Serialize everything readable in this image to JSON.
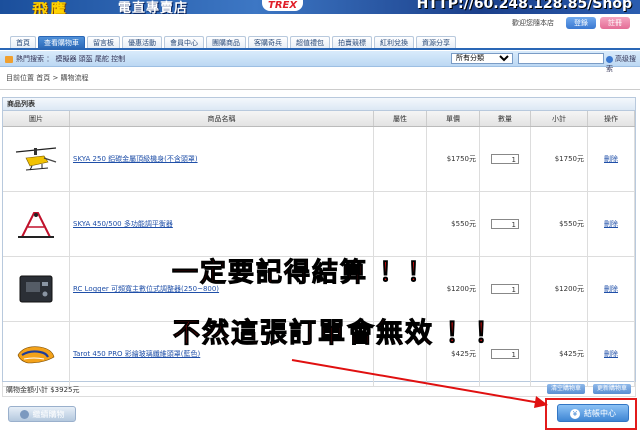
{
  "banner": {
    "logo": "飛鷹",
    "shop": "電直專賣店",
    "url": "HTTP://60.248.128.85/Shop",
    "decal": "TREX"
  },
  "user": {
    "welcome": "歡迎您隨本店",
    "login": "登錄",
    "register": "註冊"
  },
  "nav": {
    "tabs": [
      "首頁",
      "查看購物車",
      "留言板",
      "優惠活動",
      "會員中心",
      "團購商品",
      "客購奇兵",
      "超值禮包",
      "拍賣競標",
      "紅利兌換",
      "資源分享"
    ],
    "active_index": 1
  },
  "hot_search": {
    "label": "熱門搜索 ： 模擬器 頭盔 尾舵 控制",
    "category": "所有分類",
    "advanced": "高级搜索"
  },
  "breadcrumb": "目前位置 首頁 > 購物流程",
  "cart": {
    "panel_title": "商品列表",
    "headers": [
      "圖片",
      "商品名稱",
      "屬性",
      "單價",
      "數量",
      "小計",
      "操作"
    ],
    "items": [
      {
        "name": "SKYA 250 鋁碳金屬頂級機身(不含頭罩)",
        "price": "$1750元",
        "qty": "1",
        "subtotal": "$1750元",
        "action": "刪除"
      },
      {
        "name": "SKYA 450/500 多功能調平衡器",
        "price": "$550元",
        "qty": "1",
        "subtotal": "$550元",
        "action": "刪除"
      },
      {
        "name": "RC Logger 可頻寬主數位式調整器(250~800)",
        "price": "$1200元",
        "qty": "1",
        "subtotal": "$1200元",
        "action": "刪除"
      },
      {
        "name": "Tarot 450 PRO 彩繪玻璃纖維頭罩(藍色)",
        "price": "$425元",
        "qty": "1",
        "subtotal": "$425元",
        "action": "刪除"
      }
    ],
    "total_label": "購物金額小計 $3925元",
    "clear_cart": "清空購物車",
    "update_cart": "更新購物車"
  },
  "actions": {
    "continue": "繼續購物",
    "checkout": "結帳中心"
  },
  "annotation": {
    "line1": "一定要記得結算 ！！",
    "line2": "不然這張訂單會無效 ！！",
    "color": "#e01010"
  }
}
